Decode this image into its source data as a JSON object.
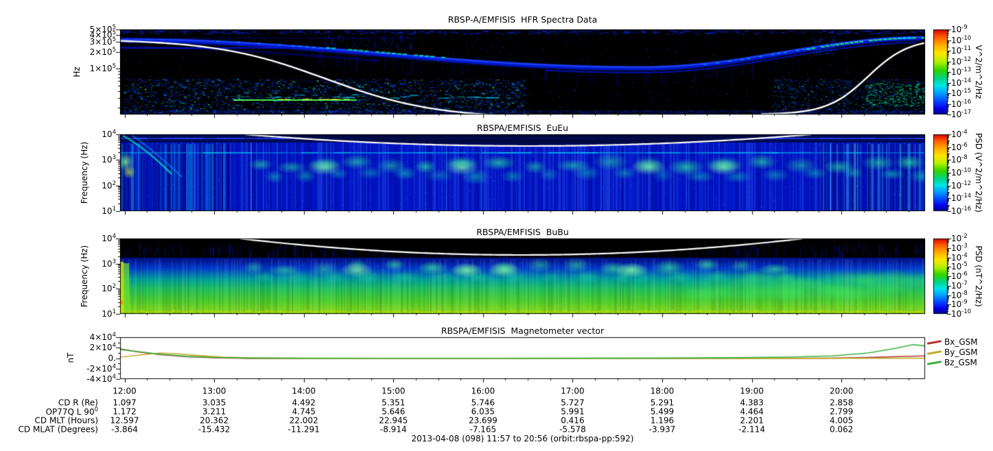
{
  "figure": {
    "caption": "2013-04-08 (098) 11:57 to 20:56 (orbit:rbspa-pp:592)",
    "time_axis": {
      "start": "11:57",
      "end": "20:56",
      "start_hour": 11.95,
      "end_hour": 20.9333,
      "hour_ticks": [
        "12:00",
        "13:00",
        "14:00",
        "15:00",
        "16:00",
        "17:00",
        "18:00",
        "19:00",
        "20:00"
      ],
      "minor_tick_interval_minutes": 15
    }
  },
  "legend": [
    {
      "label": "Bx_GSM",
      "color": "#b03434"
    },
    {
      "label": "By_GSM",
      "color": "#c0ac2c"
    },
    {
      "label": "Bz_GSM",
      "color": "#3cb03c"
    }
  ],
  "ephemeris": {
    "rows": [
      {
        "label": "CD R (Re)",
        "values": [
          "1.097",
          "3.035",
          "4.492",
          "5.351",
          "5.746",
          "5.727",
          "5.291",
          "4.383",
          "2.858"
        ]
      },
      {
        "label": "OP77Q L 90^0",
        "values": [
          "1.172",
          "3.211",
          "4.745",
          "5.646",
          "6.035",
          "5.991",
          "5.499",
          "4.464",
          "2.799"
        ]
      },
      {
        "label": "CD MLT (Hours)",
        "values": [
          "12.597",
          "20.362",
          "22.002",
          "22.945",
          "23.699",
          "0.416",
          "1.196",
          "2.201",
          "4.005"
        ]
      },
      {
        "label": "CD MLAT (Degrees)",
        "values": [
          "-3.864",
          "-15.432",
          "-11.291",
          "-8.914",
          "-7.165",
          "-5.578",
          "-3.937",
          "-2.114",
          "0.062"
        ]
      }
    ]
  },
  "chart_data": [
    {
      "id": "hfr",
      "type": "heatmap",
      "title": "RBSP-A/EMFISIS  HFR Spectra Data",
      "ylabel": "Hz",
      "yscale": "log",
      "ylim": [
        15200,
        501000
      ],
      "yticks": [
        {
          "label": "5×10^5",
          "value": 500000
        },
        {
          "label": "4×10^5",
          "value": 400000
        },
        {
          "label": "3×10^5",
          "value": 300000
        },
        {
          "label": "2×10^5",
          "value": 200000
        },
        {
          "label": "1×10^5",
          "value": 100000
        }
      ],
      "colorbar": {
        "unit": "V^2/m^2/Hz",
        "scale": "log rainbow",
        "tick_labels": [
          "10^-9",
          "10^-10",
          "10^-11",
          "10^-12",
          "10^-13",
          "10^-14",
          "10^-15",
          "10^-16",
          "10^-17"
        ]
      },
      "overlay": "white cyclotron-frequency curve: high near 12:00 and after 20:30, below plotted range mid-orbit",
      "features": [
        "black background with sparse faint blue noise speckle",
        "upper-hybrid emission band descending from ~4e5 Hz at 12:00 to ~1.2e5 Hz mid-orbit, rising again after 19:30, with cyan-green enhancement on its upper edge",
        "broadband bursty emission below ~5e4 Hz from 12:00 to ~16:00 and again after ~19:40",
        "thin blue horizontal interference lines near the bottom edge across the full interval"
      ]
    },
    {
      "id": "euu",
      "type": "heatmap",
      "title": "RBSPA/EMFISIS  EuEu",
      "ylabel": "Frequency (Hz)",
      "yscale": "log",
      "ylim": [
        10,
        10000
      ],
      "yticks": [
        {
          "label": "10^4",
          "value": 10000
        },
        {
          "label": "10^3",
          "value": 1000
        },
        {
          "label": "10^2",
          "value": 100
        },
        {
          "label": "10^1",
          "value": 10
        }
      ],
      "colorbar": {
        "unit": "PSD (V^2/m^2/Hz)",
        "scale": "log rainbow",
        "tick_labels": [
          "10^-4",
          "10^-6",
          "10^-8",
          "10^-10",
          "10^-12",
          "10^-14",
          "10^-16"
        ]
      },
      "overlay": "white fce curve dipping to ~2e3 Hz mid-orbit between ~13:20 and ~18:50",
      "features": [
        "blue broadband background with strong vertical striations",
        "cyan-green hiss/chorus blobs between ~100 Hz and ~1 kHz across the whole interval",
        "narrow bright line near 2e3 Hz",
        "dark navy band above fce and at the top edge"
      ]
    },
    {
      "id": "bub",
      "type": "heatmap",
      "title": "RBSPA/EMFISIS  BuBu",
      "ylabel": "Frequency (Hz)",
      "yscale": "log",
      "ylim": [
        10,
        10000
      ],
      "yticks": [
        {
          "label": "10^4",
          "value": 10000
        },
        {
          "label": "10^3",
          "value": 1000
        },
        {
          "label": "10^2",
          "value": 100
        },
        {
          "label": "10^1",
          "value": 10
        }
      ],
      "colorbar": {
        "unit": "PSD (nT^2/Hz)",
        "scale": "log rainbow",
        "tick_labels": [
          "10^-2",
          "10^-3",
          "10^-4",
          "10^-5",
          "10^-6",
          "10^-7",
          "10^-8",
          "10^-9",
          "10^-10"
        ]
      },
      "overlay": "white fce curve dipping to ~2e3 Hz mid-orbit between ~13:20 and ~18:45",
      "features": [
        "black above ~2 kHz with faint dark-blue vertical wisps",
        "intense green band below ~300 Hz brightening toward 10 Hz",
        "cyan-green wave blobs 100 Hz - 1 kHz aligned with the electric-field blobs",
        "bright yellow-green column at the left edge near perigee"
      ]
    },
    {
      "id": "mag",
      "type": "line",
      "title": "RBSPA/EMFISIS  Magnetometer vector",
      "ylabel": "nT",
      "ylim": [
        -40000,
        40000
      ],
      "yticks": [
        {
          "label": "4×10^4",
          "value": 40000
        },
        {
          "label": "2×10^4",
          "value": 20000
        },
        {
          "label": "0.",
          "value": 0
        },
        {
          "label": "-2×10^4",
          "value": -20000
        },
        {
          "label": "-4×10^4",
          "value": -40000
        }
      ],
      "x_unit": "hours UT",
      "series": [
        {
          "name": "Bx_GSM",
          "color": "#b03434",
          "points": [
            [
              11.95,
              17500
            ],
            [
              12.15,
              12000
            ],
            [
              12.4,
              6500
            ],
            [
              12.7,
              2800
            ],
            [
              13.0,
              800
            ],
            [
              13.4,
              -500
            ],
            [
              14.0,
              -1000
            ],
            [
              15.0,
              -1000
            ],
            [
              16.0,
              -900
            ],
            [
              17.0,
              -750
            ],
            [
              18.0,
              -600
            ],
            [
              19.0,
              -400
            ],
            [
              19.8,
              -100
            ],
            [
              20.3,
              1200
            ],
            [
              20.7,
              3200
            ],
            [
              20.93,
              4300
            ]
          ]
        },
        {
          "name": "By_GSM",
          "color": "#c0ac2c",
          "points": [
            [
              11.95,
              2000
            ],
            [
              12.15,
              5500
            ],
            [
              12.4,
              9800
            ],
            [
              12.6,
              8200
            ],
            [
              12.85,
              4800
            ],
            [
              13.1,
              2000
            ],
            [
              13.5,
              100
            ],
            [
              14.0,
              -500
            ],
            [
              15.0,
              -700
            ],
            [
              16.0,
              -700
            ],
            [
              17.0,
              -650
            ],
            [
              18.0,
              -550
            ],
            [
              19.0,
              -450
            ],
            [
              20.0,
              -350
            ],
            [
              20.93,
              -200
            ]
          ]
        },
        {
          "name": "Bz_GSM",
          "color": "#3cb03c",
          "points": [
            [
              11.95,
              16500
            ],
            [
              12.15,
              12500
            ],
            [
              12.4,
              7500
            ],
            [
              12.7,
              3500
            ],
            [
              13.0,
              1400
            ],
            [
              13.4,
              200
            ],
            [
              14.0,
              -200
            ],
            [
              15.0,
              -350
            ],
            [
              16.0,
              -350
            ],
            [
              17.0,
              -200
            ],
            [
              18.0,
              150
            ],
            [
              18.8,
              800
            ],
            [
              19.4,
              1900
            ],
            [
              19.9,
              4200
            ],
            [
              20.3,
              9800
            ],
            [
              20.6,
              18800
            ],
            [
              20.8,
              25800
            ],
            [
              20.93,
              23500
            ]
          ]
        }
      ]
    }
  ]
}
